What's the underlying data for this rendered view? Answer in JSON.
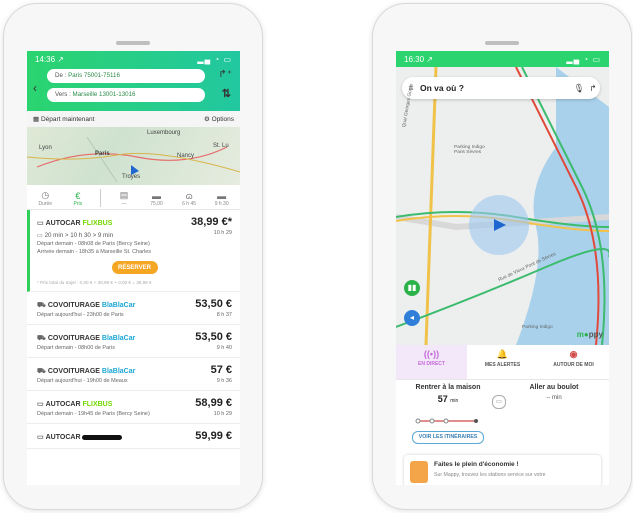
{
  "left": {
    "status_time": "14:36 ↗",
    "from_label": "De : ",
    "from_value": "Paris 75001-75116",
    "to_label": "Vers : ",
    "to_value": "Marseille 13001-13016",
    "depart": "Départ maintenant",
    "options": "Options",
    "map_labels": [
      "Luxembourg",
      "Lyon",
      "Paris",
      "Nancy",
      "St. Lu",
      "Troyes"
    ],
    "modes": [
      {
        "label": "Durée",
        "icon": "clock-icon"
      },
      {
        "label": "Prix",
        "icon": "euro-icon"
      },
      {
        "label": "—",
        "icon": "train-icon"
      },
      {
        "label": "75,00",
        "icon": "car-icon"
      },
      {
        "label": "6 h 45",
        "icon": "bike-icon"
      },
      {
        "label": "9 h 30",
        "icon": "car2-icon"
      }
    ],
    "results": [
      {
        "type": "AUTOCAR",
        "brand": "FLIXBUS",
        "brand_kind": "flix",
        "price": "38,99 €*",
        "legs": "20 min  >  10 h 30  >  9 min",
        "duration": "10 h 29",
        "line1": "Départ demain - 08h08 de Paris (Bercy Seine)",
        "line2": "Arrivée demain - 18h35 à Marseille St. Charles",
        "reserve": "RÉSERVER",
        "note": "* Prix total du trajet : 0,00 € + 38,99 € + 0,00 € = 38,99 €"
      },
      {
        "type": "COVOITURAGE",
        "brand": "BlaBlaCar",
        "brand_kind": "bla",
        "price": "53,50 €",
        "line1": "Départ aujourd'hui - 23h00 de Paris",
        "duration": "8 h 37"
      },
      {
        "type": "COVOITURAGE",
        "brand": "BlaBlaCar",
        "brand_kind": "bla",
        "price": "53,50 €",
        "line1": "Départ demain - 08h00 de Paris",
        "duration": "9 h 40"
      },
      {
        "type": "COVOITURAGE",
        "brand": "BlaBlaCar",
        "brand_kind": "bla",
        "price": "57 €",
        "line1": "Départ aujourd'hui - 19h00 de Meaux",
        "duration": "9 h 36"
      },
      {
        "type": "AUTOCAR",
        "brand": "FLIXBUS",
        "brand_kind": "flix",
        "price": "58,99 €",
        "line1": "Départ demain - 19h45 de Paris (Bercy Seine)",
        "duration": "10 h 29"
      },
      {
        "type": "AUTOCAR",
        "brand": "",
        "brand_kind": "flix",
        "price": "59,99 €",
        "line1": "",
        "duration": ""
      }
    ]
  },
  "right": {
    "status_time": "16:30 ↗",
    "search_placeholder": "On va où ?",
    "map_labels": [
      "Parking Indigo Paris Sèvres",
      "Quai Georges Gorse",
      "Rue de Vieux Pont de Sèvres",
      "Parking Indigo"
    ],
    "mappy": "m",
    "mappy2": "ppy",
    "tabs": [
      {
        "label": "EN DIRECT",
        "icon": "live-icon",
        "active": true
      },
      {
        "label": "MES ALERTES",
        "icon": "bell-icon",
        "active": false
      },
      {
        "label": "AUTOUR DE MOI",
        "icon": "nearby-icon",
        "active": false
      }
    ],
    "commute": {
      "home_title": "Rentrer à la maison",
      "home_time": "57",
      "home_unit": "min",
      "work_title": "Aller au boulot",
      "work_time": "-- min",
      "itin_button": "VOIR LES ITINÉRAIRES"
    },
    "promo": {
      "title": "Faites le plein d'économie !",
      "subtitle": "Sur Mappy, trouvez les stations service sur votre"
    }
  }
}
